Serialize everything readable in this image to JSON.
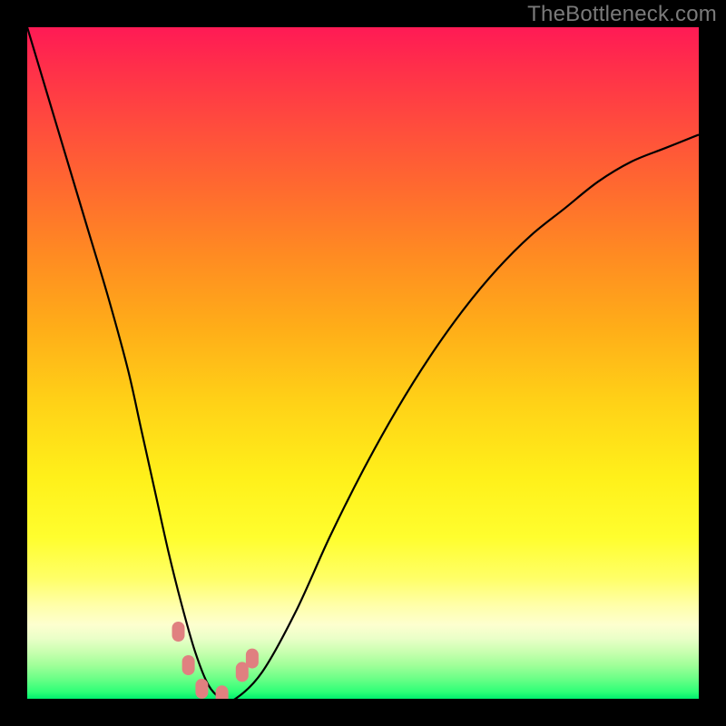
{
  "watermark": "TheBottleneck.com",
  "chart_data": {
    "type": "line",
    "title": "",
    "xlabel": "",
    "ylabel": "",
    "xlim": [
      0,
      100
    ],
    "ylim": [
      0,
      100
    ],
    "grid": false,
    "legend": false,
    "series": [
      {
        "name": "bottleneck-curve",
        "x": [
          0,
          3,
          6,
          9,
          12,
          15,
          17,
          19,
          21,
          23,
          25,
          27,
          29,
          31,
          35,
          40,
          45,
          50,
          55,
          60,
          65,
          70,
          75,
          80,
          85,
          90,
          95,
          100
        ],
        "y": [
          100,
          90,
          80,
          70,
          60,
          49,
          40,
          31,
          22,
          14,
          7,
          2,
          0,
          0,
          4,
          13,
          24,
          34,
          43,
          51,
          58,
          64,
          69,
          73,
          77,
          80,
          82,
          84
        ],
        "color": "#000000"
      }
    ],
    "markers": {
      "name": "highlight-points",
      "color": "#e08080",
      "points": [
        {
          "x": 22.5,
          "y": 10
        },
        {
          "x": 24.0,
          "y": 5
        },
        {
          "x": 26.0,
          "y": 1.5
        },
        {
          "x": 29.0,
          "y": 0.5
        },
        {
          "x": 32.0,
          "y": 4
        },
        {
          "x": 33.5,
          "y": 6
        }
      ]
    },
    "background_gradient": {
      "top": "#ff1a55",
      "mid": "#fff01a",
      "bottom": "#00ef6e"
    }
  }
}
